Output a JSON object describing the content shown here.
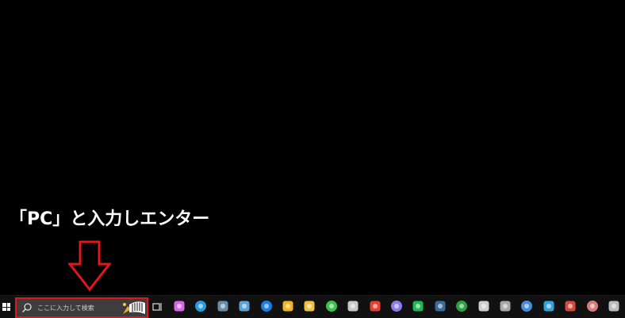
{
  "annotation": {
    "instruction_text": "「PC」と入力しエンター",
    "arrow_color": "#e0181e"
  },
  "taskbar": {
    "search": {
      "placeholder": "ここに入力して検索",
      "border_color": "#e0181e"
    },
    "pinned_apps": [
      {
        "name": "copilot-icon",
        "color": "#d667e8"
      },
      {
        "name": "edge-icon",
        "color": "#2a9cde"
      },
      {
        "name": "calculator-icon",
        "color": "#6b8ea7"
      },
      {
        "name": "notepad-icon",
        "color": "#5aa4d8"
      },
      {
        "name": "calendar-icon",
        "color": "#1a7fe0"
      },
      {
        "name": "weather-icon",
        "color": "#f2b51e"
      },
      {
        "name": "file-explorer-icon",
        "color": "#f0c040"
      },
      {
        "name": "headset-icon",
        "color": "#3ac24e"
      },
      {
        "name": "paint-icon",
        "color": "#c8c8c8"
      },
      {
        "name": "chrome-icon",
        "color": "#e34133"
      },
      {
        "name": "discord-icon",
        "color": "#8d7ce8"
      },
      {
        "name": "spotify-icon",
        "color": "#1db954"
      },
      {
        "name": "steam-icon",
        "color": "#3b6b9c"
      },
      {
        "name": "xbox-icon",
        "color": "#2ea043"
      },
      {
        "name": "egg-app-icon",
        "color": "#cfcfcf"
      },
      {
        "name": "disk-app-icon",
        "color": "#a8a8a8"
      },
      {
        "name": "news-icon",
        "color": "#4a8cd8"
      },
      {
        "name": "remote-desktop-icon",
        "color": "#32a4d8"
      },
      {
        "name": "chrome-profile-icon",
        "color": "#d44a3c"
      },
      {
        "name": "avatar-app-icon",
        "color": "#d87a7a"
      },
      {
        "name": "monitor-app-icon",
        "color": "#bcbcbc"
      }
    ]
  }
}
